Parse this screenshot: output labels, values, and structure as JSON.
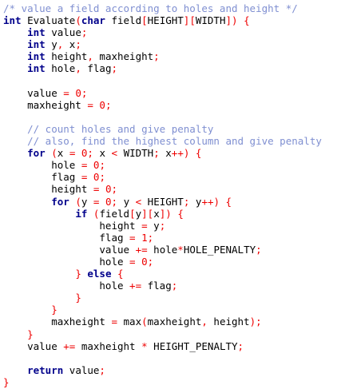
{
  "code": {
    "lines": [
      [
        {
          "c": "com",
          "t": "/* value a field according to holes and height */"
        }
      ],
      [
        {
          "c": "kw",
          "t": "int"
        },
        {
          "c": "plain",
          "t": " Evaluate"
        },
        {
          "c": "op",
          "t": "("
        },
        {
          "c": "kw",
          "t": "char"
        },
        {
          "c": "plain",
          "t": " field"
        },
        {
          "c": "op",
          "t": "["
        },
        {
          "c": "plain",
          "t": "HEIGHT"
        },
        {
          "c": "op",
          "t": "]["
        },
        {
          "c": "plain",
          "t": "WIDTH"
        },
        {
          "c": "op",
          "t": "])"
        },
        {
          "c": "plain",
          "t": " "
        },
        {
          "c": "op",
          "t": "{"
        }
      ],
      [
        {
          "c": "plain",
          "t": "    "
        },
        {
          "c": "kw",
          "t": "int"
        },
        {
          "c": "plain",
          "t": " value"
        },
        {
          "c": "op",
          "t": ";"
        }
      ],
      [
        {
          "c": "plain",
          "t": "    "
        },
        {
          "c": "kw",
          "t": "int"
        },
        {
          "c": "plain",
          "t": " y"
        },
        {
          "c": "op",
          "t": ","
        },
        {
          "c": "plain",
          "t": " x"
        },
        {
          "c": "op",
          "t": ";"
        }
      ],
      [
        {
          "c": "plain",
          "t": "    "
        },
        {
          "c": "kw",
          "t": "int"
        },
        {
          "c": "plain",
          "t": " height"
        },
        {
          "c": "op",
          "t": ","
        },
        {
          "c": "plain",
          "t": " maxheight"
        },
        {
          "c": "op",
          "t": ";"
        }
      ],
      [
        {
          "c": "plain",
          "t": "    "
        },
        {
          "c": "kw",
          "t": "int"
        },
        {
          "c": "plain",
          "t": " hole"
        },
        {
          "c": "op",
          "t": ","
        },
        {
          "c": "plain",
          "t": " flag"
        },
        {
          "c": "op",
          "t": ";"
        }
      ],
      [],
      [
        {
          "c": "plain",
          "t": "    value "
        },
        {
          "c": "op",
          "t": "="
        },
        {
          "c": "plain",
          "t": " "
        },
        {
          "c": "num",
          "t": "0"
        },
        {
          "c": "op",
          "t": ";"
        }
      ],
      [
        {
          "c": "plain",
          "t": "    maxheight "
        },
        {
          "c": "op",
          "t": "="
        },
        {
          "c": "plain",
          "t": " "
        },
        {
          "c": "num",
          "t": "0"
        },
        {
          "c": "op",
          "t": ";"
        }
      ],
      [],
      [
        {
          "c": "plain",
          "t": "    "
        },
        {
          "c": "com",
          "t": "// count holes and give penalty"
        }
      ],
      [
        {
          "c": "plain",
          "t": "    "
        },
        {
          "c": "com",
          "t": "// also, find the highest column and give penalty"
        }
      ],
      [
        {
          "c": "plain",
          "t": "    "
        },
        {
          "c": "kw",
          "t": "for"
        },
        {
          "c": "plain",
          "t": " "
        },
        {
          "c": "op",
          "t": "("
        },
        {
          "c": "plain",
          "t": "x "
        },
        {
          "c": "op",
          "t": "="
        },
        {
          "c": "plain",
          "t": " "
        },
        {
          "c": "num",
          "t": "0"
        },
        {
          "c": "op",
          "t": ";"
        },
        {
          "c": "plain",
          "t": " x "
        },
        {
          "c": "op",
          "t": "<"
        },
        {
          "c": "plain",
          "t": " WIDTH"
        },
        {
          "c": "op",
          "t": ";"
        },
        {
          "c": "plain",
          "t": " x"
        },
        {
          "c": "op",
          "t": "++)"
        },
        {
          "c": "plain",
          "t": " "
        },
        {
          "c": "op",
          "t": "{"
        }
      ],
      [
        {
          "c": "plain",
          "t": "        hole "
        },
        {
          "c": "op",
          "t": "="
        },
        {
          "c": "plain",
          "t": " "
        },
        {
          "c": "num",
          "t": "0"
        },
        {
          "c": "op",
          "t": ";"
        }
      ],
      [
        {
          "c": "plain",
          "t": "        flag "
        },
        {
          "c": "op",
          "t": "="
        },
        {
          "c": "plain",
          "t": " "
        },
        {
          "c": "num",
          "t": "0"
        },
        {
          "c": "op",
          "t": ";"
        }
      ],
      [
        {
          "c": "plain",
          "t": "        height "
        },
        {
          "c": "op",
          "t": "="
        },
        {
          "c": "plain",
          "t": " "
        },
        {
          "c": "num",
          "t": "0"
        },
        {
          "c": "op",
          "t": ";"
        }
      ],
      [
        {
          "c": "plain",
          "t": "        "
        },
        {
          "c": "kw",
          "t": "for"
        },
        {
          "c": "plain",
          "t": " "
        },
        {
          "c": "op",
          "t": "("
        },
        {
          "c": "plain",
          "t": "y "
        },
        {
          "c": "op",
          "t": "="
        },
        {
          "c": "plain",
          "t": " "
        },
        {
          "c": "num",
          "t": "0"
        },
        {
          "c": "op",
          "t": ";"
        },
        {
          "c": "plain",
          "t": " y "
        },
        {
          "c": "op",
          "t": "<"
        },
        {
          "c": "plain",
          "t": " HEIGHT"
        },
        {
          "c": "op",
          "t": ";"
        },
        {
          "c": "plain",
          "t": " y"
        },
        {
          "c": "op",
          "t": "++)"
        },
        {
          "c": "plain",
          "t": " "
        },
        {
          "c": "op",
          "t": "{"
        }
      ],
      [
        {
          "c": "plain",
          "t": "            "
        },
        {
          "c": "kw",
          "t": "if"
        },
        {
          "c": "plain",
          "t": " "
        },
        {
          "c": "op",
          "t": "("
        },
        {
          "c": "plain",
          "t": "field"
        },
        {
          "c": "op",
          "t": "["
        },
        {
          "c": "plain",
          "t": "y"
        },
        {
          "c": "op",
          "t": "]["
        },
        {
          "c": "plain",
          "t": "x"
        },
        {
          "c": "op",
          "t": "])"
        },
        {
          "c": "plain",
          "t": " "
        },
        {
          "c": "op",
          "t": "{"
        }
      ],
      [
        {
          "c": "plain",
          "t": "                height "
        },
        {
          "c": "op",
          "t": "="
        },
        {
          "c": "plain",
          "t": " y"
        },
        {
          "c": "op",
          "t": ";"
        }
      ],
      [
        {
          "c": "plain",
          "t": "                flag "
        },
        {
          "c": "op",
          "t": "="
        },
        {
          "c": "plain",
          "t": " "
        },
        {
          "c": "num",
          "t": "1"
        },
        {
          "c": "op",
          "t": ";"
        }
      ],
      [
        {
          "c": "plain",
          "t": "                value "
        },
        {
          "c": "op",
          "t": "+="
        },
        {
          "c": "plain",
          "t": " hole"
        },
        {
          "c": "op",
          "t": "*"
        },
        {
          "c": "plain",
          "t": "HOLE_PENALTY"
        },
        {
          "c": "op",
          "t": ";"
        }
      ],
      [
        {
          "c": "plain",
          "t": "                hole "
        },
        {
          "c": "op",
          "t": "="
        },
        {
          "c": "plain",
          "t": " "
        },
        {
          "c": "num",
          "t": "0"
        },
        {
          "c": "op",
          "t": ";"
        }
      ],
      [
        {
          "c": "plain",
          "t": "            "
        },
        {
          "c": "op",
          "t": "}"
        },
        {
          "c": "plain",
          "t": " "
        },
        {
          "c": "kw",
          "t": "else"
        },
        {
          "c": "plain",
          "t": " "
        },
        {
          "c": "op",
          "t": "{"
        }
      ],
      [
        {
          "c": "plain",
          "t": "                hole "
        },
        {
          "c": "op",
          "t": "+="
        },
        {
          "c": "plain",
          "t": " flag"
        },
        {
          "c": "op",
          "t": ";"
        }
      ],
      [
        {
          "c": "plain",
          "t": "            "
        },
        {
          "c": "op",
          "t": "}"
        }
      ],
      [
        {
          "c": "plain",
          "t": "        "
        },
        {
          "c": "op",
          "t": "}"
        }
      ],
      [
        {
          "c": "plain",
          "t": "        maxheight "
        },
        {
          "c": "op",
          "t": "="
        },
        {
          "c": "plain",
          "t": " max"
        },
        {
          "c": "op",
          "t": "("
        },
        {
          "c": "plain",
          "t": "maxheight"
        },
        {
          "c": "op",
          "t": ","
        },
        {
          "c": "plain",
          "t": " height"
        },
        {
          "c": "op",
          "t": ");"
        }
      ],
      [
        {
          "c": "plain",
          "t": "    "
        },
        {
          "c": "op",
          "t": "}"
        }
      ],
      [
        {
          "c": "plain",
          "t": "    value "
        },
        {
          "c": "op",
          "t": "+="
        },
        {
          "c": "plain",
          "t": " maxheight "
        },
        {
          "c": "op",
          "t": "*"
        },
        {
          "c": "plain",
          "t": " HEIGHT_PENALTY"
        },
        {
          "c": "op",
          "t": ";"
        }
      ],
      [],
      [
        {
          "c": "plain",
          "t": "    "
        },
        {
          "c": "kw",
          "t": "return"
        },
        {
          "c": "plain",
          "t": " value"
        },
        {
          "c": "op",
          "t": ";"
        }
      ],
      [
        {
          "c": "op",
          "t": "}"
        }
      ]
    ]
  }
}
